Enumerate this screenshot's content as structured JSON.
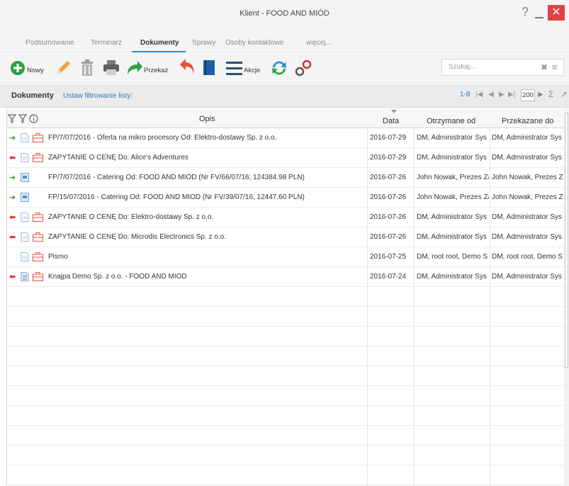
{
  "window": {
    "title": "Klient - FOOD AND MIÓD",
    "help_label": "?",
    "close_label": "✕"
  },
  "tabs": [
    {
      "label": "Podsumowanie",
      "active": false
    },
    {
      "label": "Terminarz",
      "active": false
    },
    {
      "label": "Dokumenty",
      "active": true
    },
    {
      "label": "Sprawy",
      "active": false
    },
    {
      "label": "Osoby kontaktowe",
      "active": false
    },
    {
      "label": "więcej...",
      "active": false
    }
  ],
  "toolbar": {
    "new_label": "Nowy",
    "forward_label": "Przekaż",
    "actions_label": "Akcje",
    "search_placeholder": "Szukaj...",
    "search_clear_icon": "✖",
    "search_menu_icon": "≡"
  },
  "section": {
    "title": "Dokumenty",
    "filter_link": "Ustaw filtrowanie listy:",
    "range": "1-8",
    "page_size": "200"
  },
  "colors": {
    "accent": "#2e86c1",
    "link": "#2e7bbf",
    "incoming": "#2ea043",
    "outgoing": "#d9302c",
    "case_icon": "#e2553a",
    "doc_icon": "#4a90d9"
  },
  "table": {
    "headers": {
      "opis": "Opis",
      "data": "Data",
      "from": "Otrzymane od",
      "to": "Przekazane do"
    },
    "rows": [
      {
        "direction": "in",
        "icons": [
          "doc",
          "case"
        ],
        "opis": "FP/7/07/2016 - Oferta na mikro procesory Od: Elektro-dostawy Sp. z o.o.",
        "data": "2016-07-29",
        "from": "DM, Administrator Sys",
        "to": "DM, Administrator Sys"
      },
      {
        "direction": "out",
        "icons": [
          "doc",
          "case"
        ],
        "opis": "ZAPYTANIE O CENĘ Do: Alice's Adventures",
        "data": "2016-07-29",
        "from": "DM, Administrator Sys",
        "to": "DM, Administrator Sys"
      },
      {
        "direction": "in",
        "icons": [
          "invoice"
        ],
        "opis": "FP/7/07/2016 - Catering Od: FOOD AND MIÓD (Nr FV/66/07/16; 124384.98 PLN)",
        "data": "2016-07-26",
        "from": "John Nowak, Prezes Za",
        "to": "John Nowak, Prezes Za"
      },
      {
        "direction": "in",
        "icons": [
          "invoice"
        ],
        "opis": "FP/15/07/2016 - Catering Od: FOOD AND MIÓD (Nr FV/39/07/16; 12447.60 PLN)",
        "data": "2016-07-26",
        "from": "John Nowak, Prezes Za",
        "to": "John Nowak, Prezes Za"
      },
      {
        "direction": "out",
        "icons": [
          "doc",
          "case"
        ],
        "opis": "ZAPYTANIE O CENĘ Do: Elektro-dostawy Sp. z o.o.",
        "data": "2016-07-26",
        "from": "DM, Administrator Sys",
        "to": "DM, Administrator Sys"
      },
      {
        "direction": "out",
        "icons": [
          "doc",
          "case"
        ],
        "opis": "ZAPYTANIE O CENĘ Do: Microdis Electronics Sp. z o.o.",
        "data": "2016-07-26",
        "from": "DM, Administrator Sys",
        "to": "DM, Administrator Sys"
      },
      {
        "direction": "none",
        "icons": [
          "doc",
          "case"
        ],
        "opis": "Pismo",
        "data": "2016-07-25",
        "from": "DM, root root, Demo S",
        "to": "DM, root root, Demo S"
      },
      {
        "direction": "out",
        "icons": [
          "doc-lines",
          "case"
        ],
        "opis": "Knajpa Demo Sp. z o.o. - FOOD AND MIÓD",
        "data": "2016-07-24",
        "from": "DM, Administrator Sys",
        "to": "DM, Administrator Sys"
      }
    ]
  }
}
